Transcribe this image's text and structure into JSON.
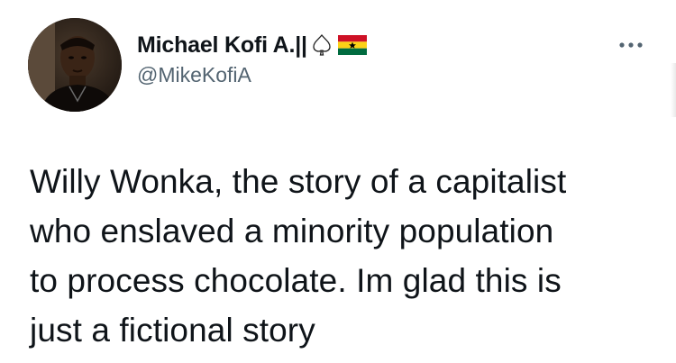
{
  "tweet": {
    "author": {
      "display_name": "Michael Kofi A.||",
      "handle": "@MikeKofiA",
      "avatar": "profile-photo",
      "badges": [
        "spade-icon",
        "ghana-flag-icon"
      ]
    },
    "more_icon": "more-options-icon",
    "text_lines": [
      "Willy Wonka, the story of a capitalist",
      "who enslaved a minority population",
      "to process chocolate. Im glad this is",
      "just a fictional story"
    ]
  },
  "colors": {
    "text": "#0f1419",
    "handle": "#536471",
    "background": "#ffffff",
    "flag_red": "#ce1126",
    "flag_gold": "#fcd116",
    "flag_green": "#006b3f",
    "flag_star": "#000000"
  }
}
